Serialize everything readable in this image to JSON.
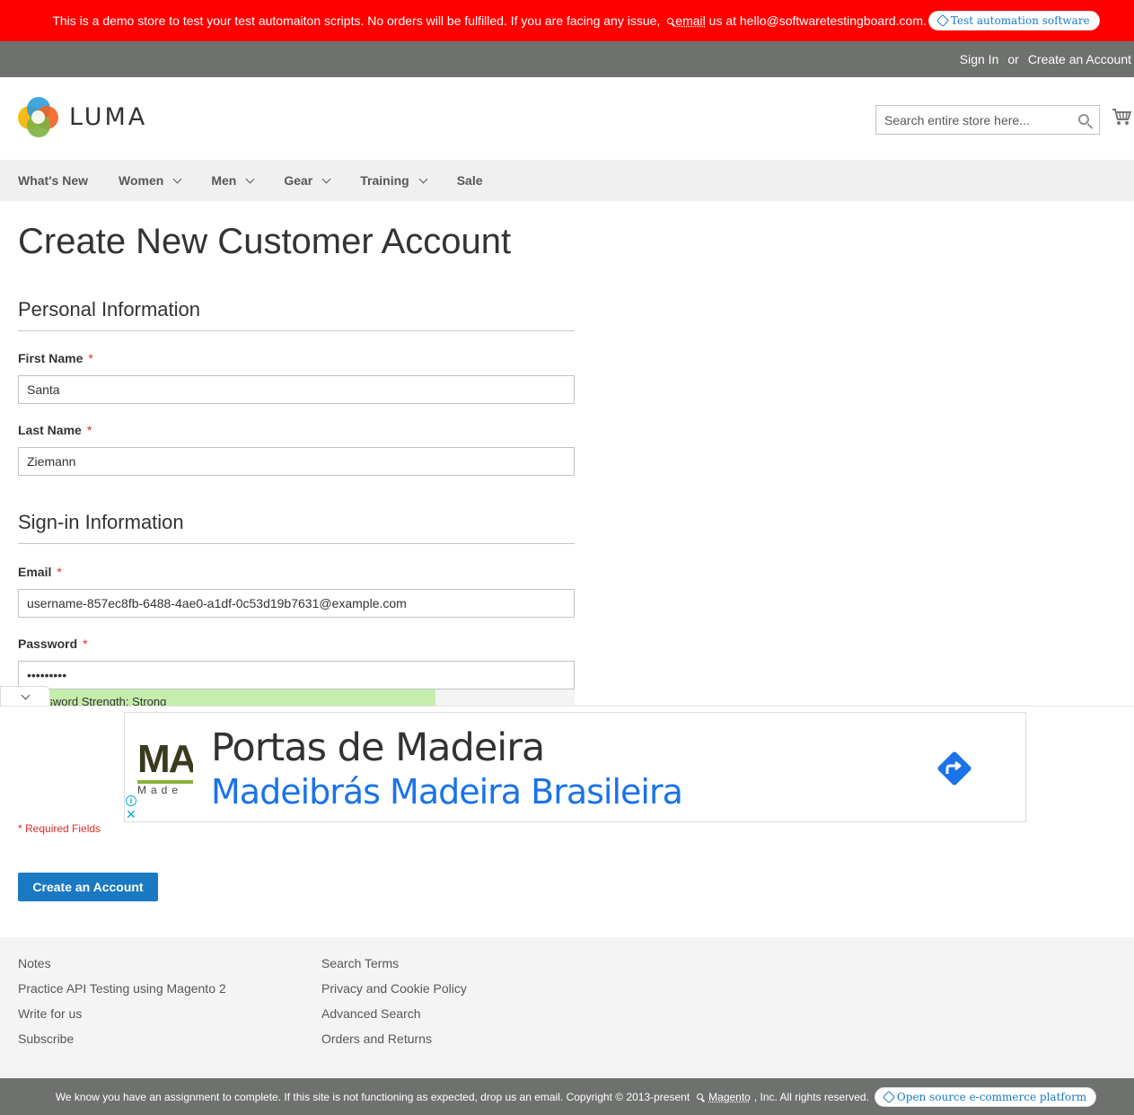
{
  "demo_notice": {
    "text": "This is a demo store to test your test automaiton scripts. No orders will be fulfilled. If you are facing any issue,",
    "email_link": "email",
    "email_text": "us at hello@softwaretestingboard.com.",
    "pill_label": "Test automation software",
    "bg_color": "#ff0000"
  },
  "header": {
    "sign_in": "Sign In",
    "or": "or",
    "create_account": "Create an Account",
    "logo_text": "LUMA",
    "search_placeholder": "Search entire store here...",
    "search_icon": "search-icon",
    "cart_icon": "cart-icon"
  },
  "nav": {
    "items": [
      {
        "label": "What's New",
        "has_dropdown": false
      },
      {
        "label": "Women",
        "has_dropdown": true
      },
      {
        "label": "Men",
        "has_dropdown": true
      },
      {
        "label": "Gear",
        "has_dropdown": true
      },
      {
        "label": "Training",
        "has_dropdown": true
      },
      {
        "label": "Sale",
        "has_dropdown": false
      }
    ]
  },
  "page": {
    "title": "Create New Customer Account"
  },
  "form": {
    "personal_legend": "Personal Information",
    "first_name_label": "First Name",
    "first_name_value": "Santa",
    "last_name_label": "Last Name",
    "last_name_value": "Ziemann",
    "signin_legend": "Sign-in Information",
    "email_label": "Email",
    "email_value": "username-857ec8fb-6488-4ae0-a1df-0c53d19b7631@example.com",
    "password_label": "Password",
    "password_value": "•••••••••",
    "password_strength": "Password Strength: Strong",
    "password_strength_fraction": 0.75,
    "required_marker": "*",
    "required_note": "* Required Fields",
    "submit_label": "Create an Account"
  },
  "ad": {
    "headline": "Portas de Madeira",
    "subline": "Madeibrás Madeira Brasileira",
    "logo_text": "MA",
    "logo_sub": "Made",
    "info_icon": "info-icon",
    "close_icon": "close-icon",
    "direction_icon": "directions-icon",
    "accent_color": "#1a73e8"
  },
  "footer": {
    "col1": [
      "Notes",
      "Practice API Testing using Magento 2",
      "Write for us",
      "Subscribe"
    ],
    "col2": [
      "Search Terms",
      "Privacy and Cookie Policy",
      "Advanced Search",
      "Orders and Returns"
    ]
  },
  "copyright": {
    "text": "We know you have an assignment to complete. If this site is not functioning as expected, drop us an email. Copyright © 2013-present",
    "magento_link": "Magento",
    "text_after": ", Inc. All rights reserved.",
    "pill_label": "Open source e-commerce platform"
  }
}
